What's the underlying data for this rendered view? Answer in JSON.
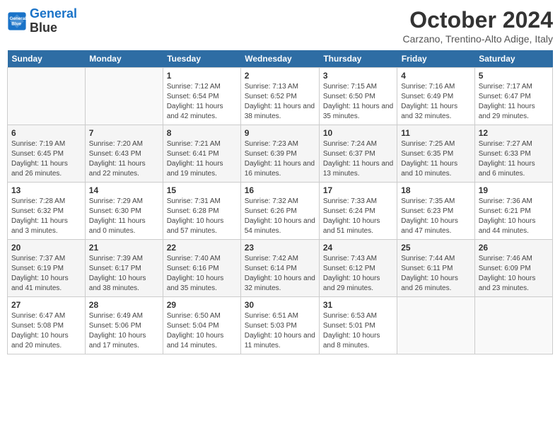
{
  "header": {
    "logo_line1": "General",
    "logo_line2": "Blue",
    "month": "October 2024",
    "location": "Carzano, Trentino-Alto Adige, Italy"
  },
  "weekdays": [
    "Sunday",
    "Monday",
    "Tuesday",
    "Wednesday",
    "Thursday",
    "Friday",
    "Saturday"
  ],
  "weeks": [
    [
      {
        "day": "",
        "sunrise": "",
        "sunset": "",
        "daylight": ""
      },
      {
        "day": "",
        "sunrise": "",
        "sunset": "",
        "daylight": ""
      },
      {
        "day": "1",
        "sunrise": "Sunrise: 7:12 AM",
        "sunset": "Sunset: 6:54 PM",
        "daylight": "Daylight: 11 hours and 42 minutes."
      },
      {
        "day": "2",
        "sunrise": "Sunrise: 7:13 AM",
        "sunset": "Sunset: 6:52 PM",
        "daylight": "Daylight: 11 hours and 38 minutes."
      },
      {
        "day": "3",
        "sunrise": "Sunrise: 7:15 AM",
        "sunset": "Sunset: 6:50 PM",
        "daylight": "Daylight: 11 hours and 35 minutes."
      },
      {
        "day": "4",
        "sunrise": "Sunrise: 7:16 AM",
        "sunset": "Sunset: 6:49 PM",
        "daylight": "Daylight: 11 hours and 32 minutes."
      },
      {
        "day": "5",
        "sunrise": "Sunrise: 7:17 AM",
        "sunset": "Sunset: 6:47 PM",
        "daylight": "Daylight: 11 hours and 29 minutes."
      }
    ],
    [
      {
        "day": "6",
        "sunrise": "Sunrise: 7:19 AM",
        "sunset": "Sunset: 6:45 PM",
        "daylight": "Daylight: 11 hours and 26 minutes."
      },
      {
        "day": "7",
        "sunrise": "Sunrise: 7:20 AM",
        "sunset": "Sunset: 6:43 PM",
        "daylight": "Daylight: 11 hours and 22 minutes."
      },
      {
        "day": "8",
        "sunrise": "Sunrise: 7:21 AM",
        "sunset": "Sunset: 6:41 PM",
        "daylight": "Daylight: 11 hours and 19 minutes."
      },
      {
        "day": "9",
        "sunrise": "Sunrise: 7:23 AM",
        "sunset": "Sunset: 6:39 PM",
        "daylight": "Daylight: 11 hours and 16 minutes."
      },
      {
        "day": "10",
        "sunrise": "Sunrise: 7:24 AM",
        "sunset": "Sunset: 6:37 PM",
        "daylight": "Daylight: 11 hours and 13 minutes."
      },
      {
        "day": "11",
        "sunrise": "Sunrise: 7:25 AM",
        "sunset": "Sunset: 6:35 PM",
        "daylight": "Daylight: 11 hours and 10 minutes."
      },
      {
        "day": "12",
        "sunrise": "Sunrise: 7:27 AM",
        "sunset": "Sunset: 6:33 PM",
        "daylight": "Daylight: 11 hours and 6 minutes."
      }
    ],
    [
      {
        "day": "13",
        "sunrise": "Sunrise: 7:28 AM",
        "sunset": "Sunset: 6:32 PM",
        "daylight": "Daylight: 11 hours and 3 minutes."
      },
      {
        "day": "14",
        "sunrise": "Sunrise: 7:29 AM",
        "sunset": "Sunset: 6:30 PM",
        "daylight": "Daylight: 11 hours and 0 minutes."
      },
      {
        "day": "15",
        "sunrise": "Sunrise: 7:31 AM",
        "sunset": "Sunset: 6:28 PM",
        "daylight": "Daylight: 10 hours and 57 minutes."
      },
      {
        "day": "16",
        "sunrise": "Sunrise: 7:32 AM",
        "sunset": "Sunset: 6:26 PM",
        "daylight": "Daylight: 10 hours and 54 minutes."
      },
      {
        "day": "17",
        "sunrise": "Sunrise: 7:33 AM",
        "sunset": "Sunset: 6:24 PM",
        "daylight": "Daylight: 10 hours and 51 minutes."
      },
      {
        "day": "18",
        "sunrise": "Sunrise: 7:35 AM",
        "sunset": "Sunset: 6:23 PM",
        "daylight": "Daylight: 10 hours and 47 minutes."
      },
      {
        "day": "19",
        "sunrise": "Sunrise: 7:36 AM",
        "sunset": "Sunset: 6:21 PM",
        "daylight": "Daylight: 10 hours and 44 minutes."
      }
    ],
    [
      {
        "day": "20",
        "sunrise": "Sunrise: 7:37 AM",
        "sunset": "Sunset: 6:19 PM",
        "daylight": "Daylight: 10 hours and 41 minutes."
      },
      {
        "day": "21",
        "sunrise": "Sunrise: 7:39 AM",
        "sunset": "Sunset: 6:17 PM",
        "daylight": "Daylight: 10 hours and 38 minutes."
      },
      {
        "day": "22",
        "sunrise": "Sunrise: 7:40 AM",
        "sunset": "Sunset: 6:16 PM",
        "daylight": "Daylight: 10 hours and 35 minutes."
      },
      {
        "day": "23",
        "sunrise": "Sunrise: 7:42 AM",
        "sunset": "Sunset: 6:14 PM",
        "daylight": "Daylight: 10 hours and 32 minutes."
      },
      {
        "day": "24",
        "sunrise": "Sunrise: 7:43 AM",
        "sunset": "Sunset: 6:12 PM",
        "daylight": "Daylight: 10 hours and 29 minutes."
      },
      {
        "day": "25",
        "sunrise": "Sunrise: 7:44 AM",
        "sunset": "Sunset: 6:11 PM",
        "daylight": "Daylight: 10 hours and 26 minutes."
      },
      {
        "day": "26",
        "sunrise": "Sunrise: 7:46 AM",
        "sunset": "Sunset: 6:09 PM",
        "daylight": "Daylight: 10 hours and 23 minutes."
      }
    ],
    [
      {
        "day": "27",
        "sunrise": "Sunrise: 6:47 AM",
        "sunset": "Sunset: 5:08 PM",
        "daylight": "Daylight: 10 hours and 20 minutes."
      },
      {
        "day": "28",
        "sunrise": "Sunrise: 6:49 AM",
        "sunset": "Sunset: 5:06 PM",
        "daylight": "Daylight: 10 hours and 17 minutes."
      },
      {
        "day": "29",
        "sunrise": "Sunrise: 6:50 AM",
        "sunset": "Sunset: 5:04 PM",
        "daylight": "Daylight: 10 hours and 14 minutes."
      },
      {
        "day": "30",
        "sunrise": "Sunrise: 6:51 AM",
        "sunset": "Sunset: 5:03 PM",
        "daylight": "Daylight: 10 hours and 11 minutes."
      },
      {
        "day": "31",
        "sunrise": "Sunrise: 6:53 AM",
        "sunset": "Sunset: 5:01 PM",
        "daylight": "Daylight: 10 hours and 8 minutes."
      },
      {
        "day": "",
        "sunrise": "",
        "sunset": "",
        "daylight": ""
      },
      {
        "day": "",
        "sunrise": "",
        "sunset": "",
        "daylight": ""
      }
    ]
  ]
}
